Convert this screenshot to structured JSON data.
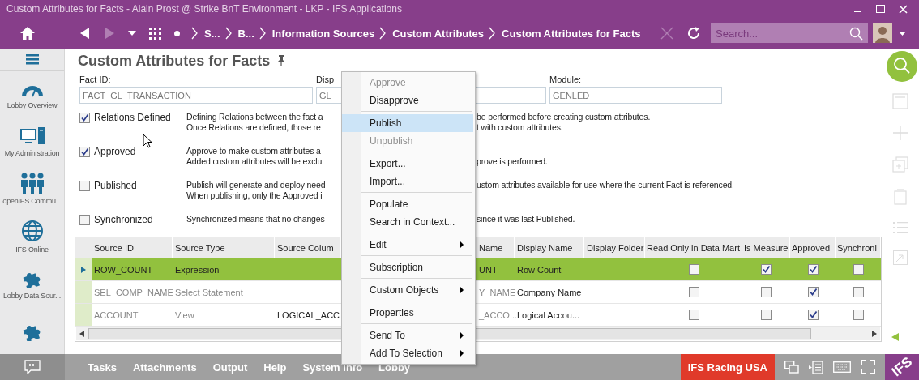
{
  "window": {
    "title": "Custom Attributes for Facts - Alain Prost @ Strike BnT Environment - LKP - IFS Applications"
  },
  "nav": {
    "forward_disabled": true,
    "breadcrumbs": [
      "S...",
      "B...",
      "Information Sources",
      "Custom Attributes",
      "Custom Attributes for Facts"
    ],
    "search": {
      "placeholder": "Search..."
    }
  },
  "sidebar": {
    "items": [
      {
        "label": "Lobby Overview"
      },
      {
        "label": "My Administration"
      },
      {
        "label": "openIFS Commu..."
      },
      {
        "label": "IFS Online"
      },
      {
        "label": "Lobby Data Sour..."
      }
    ]
  },
  "page": {
    "title": "Custom Attributes for Facts",
    "fields": [
      {
        "label": "Fact ID:",
        "value": "FACT_GL_TRANSACTION"
      },
      {
        "label": "Disp",
        "value": "GL"
      },
      {
        "label": "Module:",
        "value": "GENLED"
      }
    ],
    "flags": [
      {
        "label": "Relations Defined",
        "checked": true,
        "lines": [
          {
            "left": "Defining Relations between the fact a",
            "right": "be performed before creating custom attributes."
          },
          {
            "left": "Once Relations are defined, those re",
            "right": "t with custom attributes."
          }
        ]
      },
      {
        "label": "Approved",
        "checked": true,
        "lines": [
          {
            "left": "Approve to make custom attributes a"
          },
          {
            "left": "Added custom attributes will be exclu",
            "right": "prove is performed."
          }
        ]
      },
      {
        "label": "Published",
        "checked": false,
        "lines": [
          {
            "left": "Publish will generate and deploy need",
            "right": "ustom attributes available for use where the current Fact is referenced."
          },
          {
            "left": "When publishing, only the Approved i"
          }
        ]
      },
      {
        "label": "Synchronized",
        "checked": false,
        "lines": [
          {
            "left": "Synchronized means that no changes",
            "right": "since it was last Published."
          }
        ]
      }
    ]
  },
  "table": {
    "columns": [
      "Source ID",
      "Source Type",
      "Source Colum",
      "Name",
      "Display Name",
      "Display Folder",
      "Read Only in Data Mart",
      "Is Measure",
      "Approved",
      "Synchroni"
    ],
    "rows": [
      {
        "selected": true,
        "source_id": "ROW_COUNT",
        "source_type": "Expression",
        "name": "UNT",
        "display_name": "Row Count",
        "read_only": false,
        "is_measure": true,
        "approved": true,
        "synchronized": false
      },
      {
        "selected": false,
        "source_id": "SEL_COMP_NAME",
        "source_type": "Select Statement",
        "name": "Y_NAME",
        "display_name": "Company Name",
        "read_only": false,
        "is_measure": false,
        "approved": true,
        "synchronized": false
      },
      {
        "selected": false,
        "source_id": "ACCOUNT",
        "source_type": "View",
        "source_column": "LOGICAL_ACC",
        "name": "_ACCO...",
        "display_name": "Logical Accou...",
        "read_only": false,
        "is_measure": false,
        "approved": true,
        "synchronized": false
      }
    ]
  },
  "context_menu": {
    "items": [
      {
        "kind": "item",
        "label": "Approve",
        "disabled": true,
        "selected": false
      },
      {
        "kind": "item",
        "label": "Disapprove",
        "disabled": false,
        "selected": false
      },
      {
        "kind": "separator"
      },
      {
        "kind": "item",
        "label": "Publish",
        "disabled": false,
        "selected": true
      },
      {
        "kind": "item",
        "label": "Unpublish",
        "disabled": true,
        "selected": false
      },
      {
        "kind": "separator"
      },
      {
        "kind": "item",
        "label": "Export...",
        "disabled": false,
        "selected": false
      },
      {
        "kind": "item",
        "label": "Import...",
        "disabled": false,
        "selected": false
      },
      {
        "kind": "separator"
      },
      {
        "kind": "item",
        "label": "Populate",
        "disabled": false,
        "selected": false
      },
      {
        "kind": "item",
        "label": "Search in Context...",
        "disabled": false,
        "selected": false
      },
      {
        "kind": "separator"
      },
      {
        "kind": "item",
        "label": "Edit",
        "disabled": false,
        "selected": false,
        "submenu": true
      },
      {
        "kind": "separator"
      },
      {
        "kind": "item",
        "label": "Subscription",
        "disabled": false,
        "selected": false
      },
      {
        "kind": "separator"
      },
      {
        "kind": "item",
        "label": "Custom Objects",
        "disabled": false,
        "selected": false,
        "submenu": true
      },
      {
        "kind": "separator"
      },
      {
        "kind": "item",
        "label": "Properties",
        "disabled": false,
        "selected": false
      },
      {
        "kind": "separator"
      },
      {
        "kind": "item",
        "label": "Send To",
        "disabled": false,
        "selected": false,
        "submenu": true
      },
      {
        "kind": "item",
        "label": "Add To Selection",
        "disabled": false,
        "selected": false,
        "submenu": true
      }
    ]
  },
  "bottom_bar": {
    "tabs": [
      "Tasks",
      "Attachments",
      "Output",
      "Help",
      "System Info",
      "Lobby"
    ],
    "company": "IFS Racing USA",
    "logo": "IFS"
  }
}
